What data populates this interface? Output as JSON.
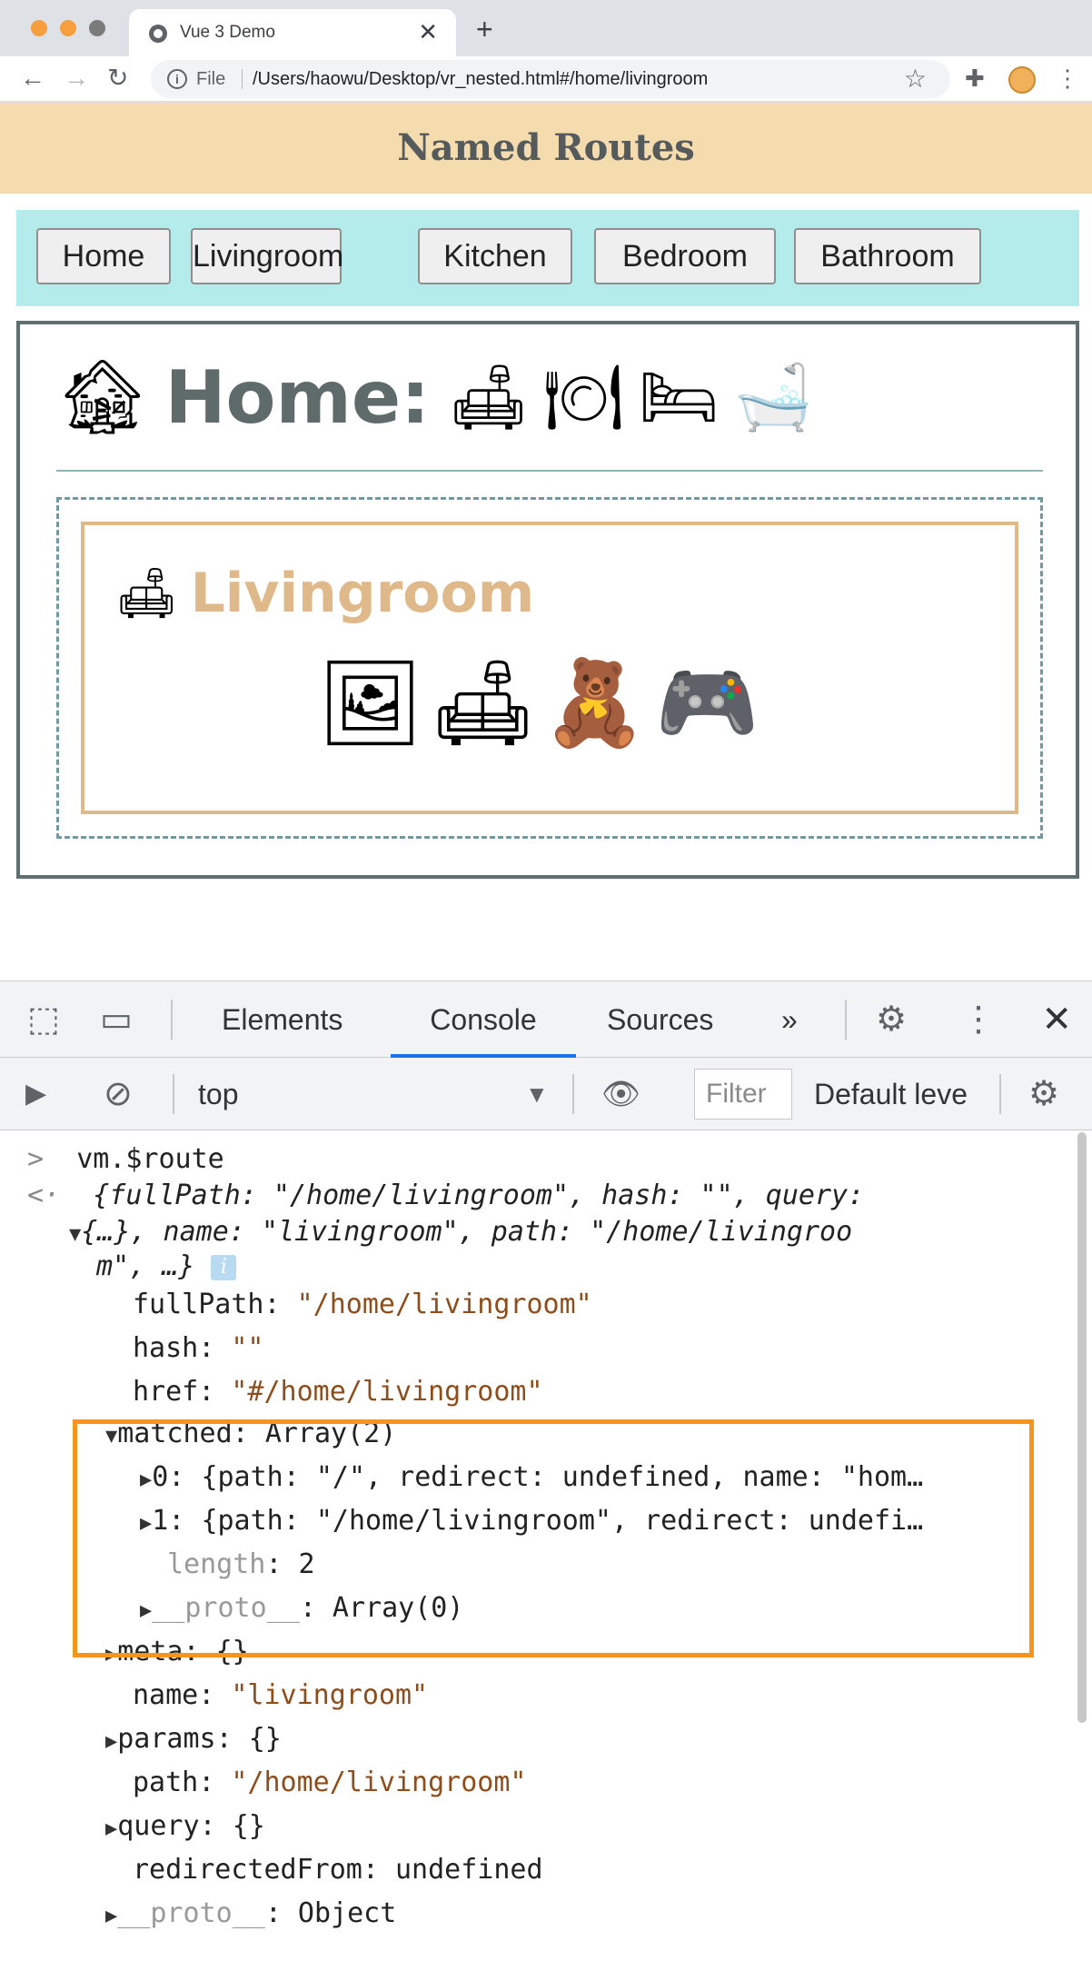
{
  "browser": {
    "tab_title": "Vue 3 Demo",
    "close_glyph": "✕",
    "new_tab_glyph": "+",
    "file_label": "File",
    "url": "/Users/haowu/Desktop/vr_nested.html#/home/livingroom",
    "back_glyph": "←",
    "forward_glyph": "→",
    "reload_glyph": "↻",
    "star_glyph": "☆",
    "extensions_glyph": "✚",
    "menu_glyph": "⋮",
    "info_glyph": "i"
  },
  "page": {
    "header_title": "Named Routes",
    "nav_buttons": [
      "Home",
      "Livingroom",
      "Kitchen",
      "Bedroom",
      "Bathroom"
    ],
    "home_emoji": "🏚",
    "home_title": "Home:",
    "home_room_emojis": [
      "🛋",
      "🍽",
      "🛏",
      "🛁"
    ],
    "livingroom_emoji": "🛋",
    "livingroom_title": "Livingroom",
    "livingroom_items": [
      "🖼",
      "🛋",
      "🧸",
      "🎮"
    ]
  },
  "devtools": {
    "tabs": [
      "Elements",
      "Console",
      "Sources"
    ],
    "active_tab": "Console",
    "more_tabs_glyph": "»",
    "context": "top",
    "filter_placeholder": "Filter",
    "levels": "Default leve",
    "inspect_glyph": "⬚",
    "device_glyph": "▭",
    "settings_glyph": "⚙",
    "menu_glyph": "⋮",
    "close_glyph": "✕",
    "sidebar_glyph": "▶",
    "clear_glyph": "⊘",
    "caret_glyph": "▼",
    "eye_glyph": "👁"
  },
  "console": {
    "input_prompt": ">",
    "input": "vm.$route",
    "result_prompt": "<·",
    "summary_line1": "{fullPath: \"/home/livingroom\", hash: \"\", query:",
    "summary_line2": "{…}, name: \"livingroom\", path: \"/home/livingroo",
    "summary_line3": "m\", …}",
    "info_badge": "i",
    "lines": {
      "fullPath_key": "fullPath: ",
      "fullPath_val": "\"/home/livingroom\"",
      "hash_key": "hash: ",
      "hash_val": "\"\"",
      "href_key": "href: ",
      "href_val": "\"#/home/livingroom\"",
      "matched_key": "matched: ",
      "matched_val": "Array(2)",
      "m0_key": "0: ",
      "m0_val": "{path: \"/\", redirect: undefined, name: \"hom…",
      "m1_key": "1: ",
      "m1_val": "{path: \"/home/livingroom\", redirect: undefi…",
      "length_key": "length",
      "length_val": ": 2",
      "proto_array_key": "__proto__",
      "proto_array_val": ": Array(0)",
      "meta_key": "meta: ",
      "meta_val": "{}",
      "name_key": "name: ",
      "name_val": "\"livingroom\"",
      "params_key": "params: ",
      "params_val": "{}",
      "path_key": "path: ",
      "path_val": "\"/home/livingroom\"",
      "query_key": "query: ",
      "query_val": "{}",
      "redirectedFrom_key": "redirectedFrom: ",
      "redirectedFrom_val": "undefined",
      "proto_obj_key": "__proto__",
      "proto_obj_val": ": Object"
    },
    "expand_open": "▼",
    "expand_closed": "▶"
  },
  "colors": {
    "header_bg": "#f5dcae",
    "nav_bg": "#b4ebeb",
    "highlight": "#f7941d",
    "string": "#8e4e1c",
    "accent_tab": "#1a73e8"
  }
}
